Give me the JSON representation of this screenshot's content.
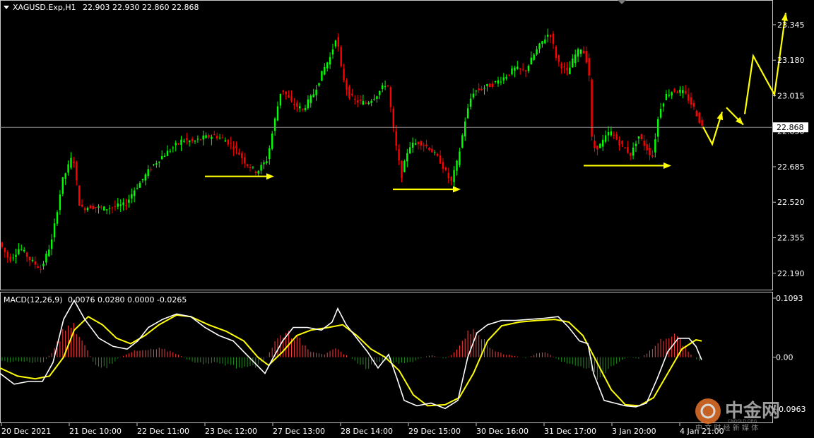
{
  "header": {
    "symbol": "XAGUSD.Exp,H1",
    "ohlc": "22.903 22.930 22.860 22.868"
  },
  "macd_header": {
    "name": "MACD(12,26,9)",
    "values": "0.0076 0.0280 0.0000 -0.0265"
  },
  "colors": {
    "background": "#000000",
    "bull": "#00ff00",
    "bear": "#ff0000",
    "annotation": "#ffff00",
    "macd_line": "#ffffff",
    "signal_line": "#ffff00",
    "hist_pos": "#ff3b3b",
    "hist_neg": "#1f8f1f"
  },
  "watermark": {
    "brand": "中金网",
    "sub": "CNGOLD.ORG",
    "tagline": "中 文 财 经 新 媒 体"
  },
  "chart_data": [
    {
      "type": "candlestick",
      "symbol": "XAGUSD.Exp",
      "timeframe": "H1",
      "current_price": "22.868",
      "y_ticks": [
        "23.345",
        "23.180",
        "23.015",
        "22.850",
        "22.685",
        "22.520",
        "22.355",
        "22.190"
      ],
      "ylim": [
        22.14,
        23.44
      ],
      "x_ticks": [
        "20 Dec 2021",
        "21 Dec 10:00",
        "22 Dec 11:00",
        "23 Dec 12:00",
        "27 Dec 13:00",
        "28 Dec 14:00",
        "29 Dec 15:00",
        "30 Dec 16:00",
        "31 Dec 17:00",
        "3 Jan 20:00",
        "4 Jan 21:00"
      ],
      "price_path": [
        [
          0,
          22.34
        ],
        [
          15,
          22.25
        ],
        [
          30,
          22.31
        ],
        [
          45,
          22.25
        ],
        [
          60,
          22.21
        ],
        [
          75,
          22.34
        ],
        [
          90,
          22.62
        ],
        [
          105,
          22.74
        ],
        [
          115,
          22.49
        ],
        [
          130,
          22.5
        ],
        [
          150,
          22.49
        ],
        [
          165,
          22.5
        ],
        [
          180,
          22.51
        ],
        [
          190,
          22.57
        ],
        [
          200,
          22.61
        ],
        [
          215,
          22.68
        ],
        [
          230,
          22.73
        ],
        [
          245,
          22.77
        ],
        [
          260,
          22.81
        ],
        [
          275,
          22.8
        ],
        [
          290,
          22.82
        ],
        [
          305,
          22.83
        ],
        [
          320,
          22.81
        ],
        [
          335,
          22.77
        ],
        [
          350,
          22.7
        ],
        [
          365,
          22.66
        ],
        [
          380,
          22.72
        ],
        [
          390,
          22.89
        ],
        [
          400,
          23.05
        ],
        [
          415,
          22.98
        ],
        [
          430,
          22.95
        ],
        [
          445,
          23.02
        ],
        [
          460,
          23.14
        ],
        [
          470,
          23.2
        ],
        [
          478,
          23.3
        ],
        [
          485,
          23.13
        ],
        [
          495,
          23.02
        ],
        [
          505,
          22.99
        ],
        [
          520,
          22.98
        ],
        [
          535,
          23.02
        ],
        [
          550,
          23.08
        ],
        [
          560,
          22.82
        ],
        [
          570,
          22.64
        ],
        [
          580,
          22.78
        ],
        [
          595,
          22.8
        ],
        [
          610,
          22.77
        ],
        [
          625,
          22.71
        ],
        [
          640,
          22.61
        ],
        [
          650,
          22.72
        ],
        [
          660,
          22.9
        ],
        [
          670,
          23.03
        ],
        [
          685,
          23.05
        ],
        [
          700,
          23.07
        ],
        [
          715,
          23.1
        ],
        [
          730,
          23.14
        ],
        [
          745,
          23.13
        ],
        [
          760,
          23.22
        ],
        [
          770,
          23.27
        ],
        [
          780,
          23.31
        ],
        [
          790,
          23.18
        ],
        [
          805,
          23.12
        ],
        [
          815,
          23.2
        ],
        [
          825,
          23.24
        ],
        [
          835,
          23.15
        ],
        [
          840,
          22.77
        ],
        [
          850,
          22.78
        ],
        [
          865,
          22.85
        ],
        [
          880,
          22.79
        ],
        [
          895,
          22.74
        ],
        [
          905,
          22.83
        ],
        [
          915,
          22.78
        ],
        [
          925,
          22.73
        ],
        [
          935,
          22.95
        ],
        [
          945,
          23.02
        ],
        [
          955,
          23.04
        ],
        [
          970,
          23.03
        ],
        [
          985,
          22.95
        ],
        [
          995,
          22.87
        ]
      ],
      "annotations": [
        {
          "type": "support-arrow",
          "from": [
            290,
            22.64
          ],
          "to": [
            388,
            22.64
          ]
        },
        {
          "type": "support-arrow",
          "from": [
            556,
            22.58
          ],
          "to": [
            652,
            22.58
          ]
        },
        {
          "type": "support-arrow",
          "from": [
            826,
            22.69
          ],
          "to": [
            950,
            22.69
          ]
        },
        {
          "type": "forecast-zigzag",
          "points": [
            [
              995,
              22.87
            ],
            [
              1008,
              22.79
            ],
            [
              1022,
              22.94
            ]
          ]
        },
        {
          "type": "forecast-zigzag",
          "points": [
            [
              1028,
              22.96
            ],
            [
              1052,
              22.88
            ]
          ]
        },
        {
          "type": "forecast-zigzag",
          "points": [
            [
              1054,
              22.93
            ],
            [
              1066,
              23.2
            ],
            [
              1096,
              23.02
            ],
            [
              1112,
              23.4
            ]
          ]
        }
      ]
    },
    {
      "type": "macd",
      "params": "MACD(12,26,9)",
      "y_ticks": [
        "0.1093",
        "0.00",
        "-0.0963"
      ],
      "ylim": [
        -0.113,
        0.1093
      ],
      "macd_line": [
        [
          0,
          -0.03
        ],
        [
          20,
          -0.05
        ],
        [
          40,
          -0.045
        ],
        [
          60,
          -0.045
        ],
        [
          75,
          -0.01
        ],
        [
          90,
          0.07
        ],
        [
          105,
          0.105
        ],
        [
          120,
          0.07
        ],
        [
          140,
          0.035
        ],
        [
          160,
          0.02
        ],
        [
          180,
          0.015
        ],
        [
          195,
          0.03
        ],
        [
          210,
          0.055
        ],
        [
          230,
          0.07
        ],
        [
          250,
          0.08
        ],
        [
          270,
          0.075
        ],
        [
          290,
          0.055
        ],
        [
          310,
          0.04
        ],
        [
          330,
          0.03
        ],
        [
          345,
          0.01
        ],
        [
          360,
          -0.01
        ],
        [
          375,
          -0.03
        ],
        [
          385,
          -0.005
        ],
        [
          400,
          0.03
        ],
        [
          415,
          0.055
        ],
        [
          435,
          0.055
        ],
        [
          455,
          0.05
        ],
        [
          470,
          0.065
        ],
        [
          478,
          0.09
        ],
        [
          490,
          0.06
        ],
        [
          505,
          0.035
        ],
        [
          520,
          0.01
        ],
        [
          535,
          -0.02
        ],
        [
          550,
          0.005
        ],
        [
          562,
          -0.04
        ],
        [
          572,
          -0.08
        ],
        [
          590,
          -0.09
        ],
        [
          610,
          -0.085
        ],
        [
          630,
          -0.095
        ],
        [
          648,
          -0.08
        ],
        [
          662,
          0.0
        ],
        [
          675,
          0.045
        ],
        [
          690,
          0.06
        ],
        [
          710,
          0.068
        ],
        [
          730,
          0.068
        ],
        [
          750,
          0.07
        ],
        [
          770,
          0.072
        ],
        [
          790,
          0.075
        ],
        [
          805,
          0.055
        ],
        [
          820,
          0.03
        ],
        [
          832,
          0.025
        ],
        [
          840,
          -0.03
        ],
        [
          855,
          -0.08
        ],
        [
          870,
          -0.085
        ],
        [
          885,
          -0.09
        ],
        [
          900,
          -0.092
        ],
        [
          915,
          -0.085
        ],
        [
          930,
          -0.04
        ],
        [
          945,
          0.01
        ],
        [
          960,
          0.035
        ],
        [
          975,
          0.035
        ],
        [
          985,
          0.02
        ],
        [
          993,
          -0.005
        ]
      ],
      "signal_line": [
        [
          0,
          -0.02
        ],
        [
          25,
          -0.035
        ],
        [
          50,
          -0.04
        ],
        [
          70,
          -0.035
        ],
        [
          90,
          0.0
        ],
        [
          105,
          0.05
        ],
        [
          125,
          0.075
        ],
        [
          145,
          0.06
        ],
        [
          165,
          0.035
        ],
        [
          185,
          0.025
        ],
        [
          205,
          0.04
        ],
        [
          225,
          0.06
        ],
        [
          250,
          0.078
        ],
        [
          270,
          0.075
        ],
        [
          295,
          0.06
        ],
        [
          320,
          0.048
        ],
        [
          345,
          0.03
        ],
        [
          365,
          0.0
        ],
        [
          380,
          -0.015
        ],
        [
          400,
          0.01
        ],
        [
          420,
          0.04
        ],
        [
          440,
          0.05
        ],
        [
          465,
          0.055
        ],
        [
          485,
          0.06
        ],
        [
          505,
          0.04
        ],
        [
          525,
          0.015
        ],
        [
          545,
          0.0
        ],
        [
          565,
          -0.025
        ],
        [
          585,
          -0.07
        ],
        [
          605,
          -0.09
        ],
        [
          630,
          -0.088
        ],
        [
          650,
          -0.075
        ],
        [
          670,
          -0.03
        ],
        [
          690,
          0.03
        ],
        [
          710,
          0.058
        ],
        [
          735,
          0.065
        ],
        [
          760,
          0.068
        ],
        [
          785,
          0.07
        ],
        [
          805,
          0.065
        ],
        [
          825,
          0.04
        ],
        [
          845,
          -0.01
        ],
        [
          865,
          -0.06
        ],
        [
          885,
          -0.088
        ],
        [
          905,
          -0.09
        ],
        [
          925,
          -0.075
        ],
        [
          945,
          -0.03
        ],
        [
          965,
          0.015
        ],
        [
          985,
          0.032
        ],
        [
          993,
          0.03
        ]
      ],
      "histogram_envelope": [
        [
          0,
          -0.008
        ],
        [
          30,
          -0.008
        ],
        [
          60,
          -0.01
        ],
        [
          75,
          0.01
        ],
        [
          90,
          0.05
        ],
        [
          105,
          0.055
        ],
        [
          120,
          0.02
        ],
        [
          135,
          -0.015
        ],
        [
          150,
          -0.02
        ],
        [
          170,
          0.0
        ],
        [
          185,
          0.01
        ],
        [
          205,
          0.012
        ],
        [
          225,
          0.015
        ],
        [
          245,
          0.01
        ],
        [
          265,
          -0.005
        ],
        [
          285,
          -0.012
        ],
        [
          305,
          -0.01
        ],
        [
          325,
          -0.015
        ],
        [
          345,
          -0.022
        ],
        [
          360,
          -0.018
        ],
        [
          375,
          -0.005
        ],
        [
          390,
          0.03
        ],
        [
          405,
          0.048
        ],
        [
          420,
          0.035
        ],
        [
          440,
          0.012
        ],
        [
          460,
          0.005
        ],
        [
          475,
          0.015
        ],
        [
          490,
          0.004
        ],
        [
          505,
          -0.01
        ],
        [
          520,
          -0.02
        ],
        [
          535,
          -0.01
        ],
        [
          550,
          -0.008
        ],
        [
          565,
          -0.012
        ],
        [
          580,
          -0.01
        ],
        [
          595,
          -0.002
        ],
        [
          610,
          0.004
        ],
        [
          630,
          -0.003
        ],
        [
          645,
          0.01
        ],
        [
          660,
          0.04
        ],
        [
          672,
          0.05
        ],
        [
          685,
          0.035
        ],
        [
          700,
          0.01
        ],
        [
          720,
          0.004
        ],
        [
          745,
          -0.002
        ],
        [
          770,
          0.012
        ],
        [
          790,
          -0.005
        ],
        [
          805,
          -0.012
        ],
        [
          820,
          -0.02
        ],
        [
          835,
          -0.02
        ],
        [
          850,
          -0.045
        ],
        [
          862,
          -0.02
        ],
        [
          875,
          -0.008
        ],
        [
          890,
          0.0
        ],
        [
          905,
          -0.003
        ],
        [
          920,
          0.012
        ],
        [
          935,
          0.03
        ],
        [
          945,
          0.042
        ],
        [
          960,
          0.035
        ],
        [
          975,
          0.008
        ],
        [
          993,
          -0.012
        ]
      ]
    }
  ]
}
